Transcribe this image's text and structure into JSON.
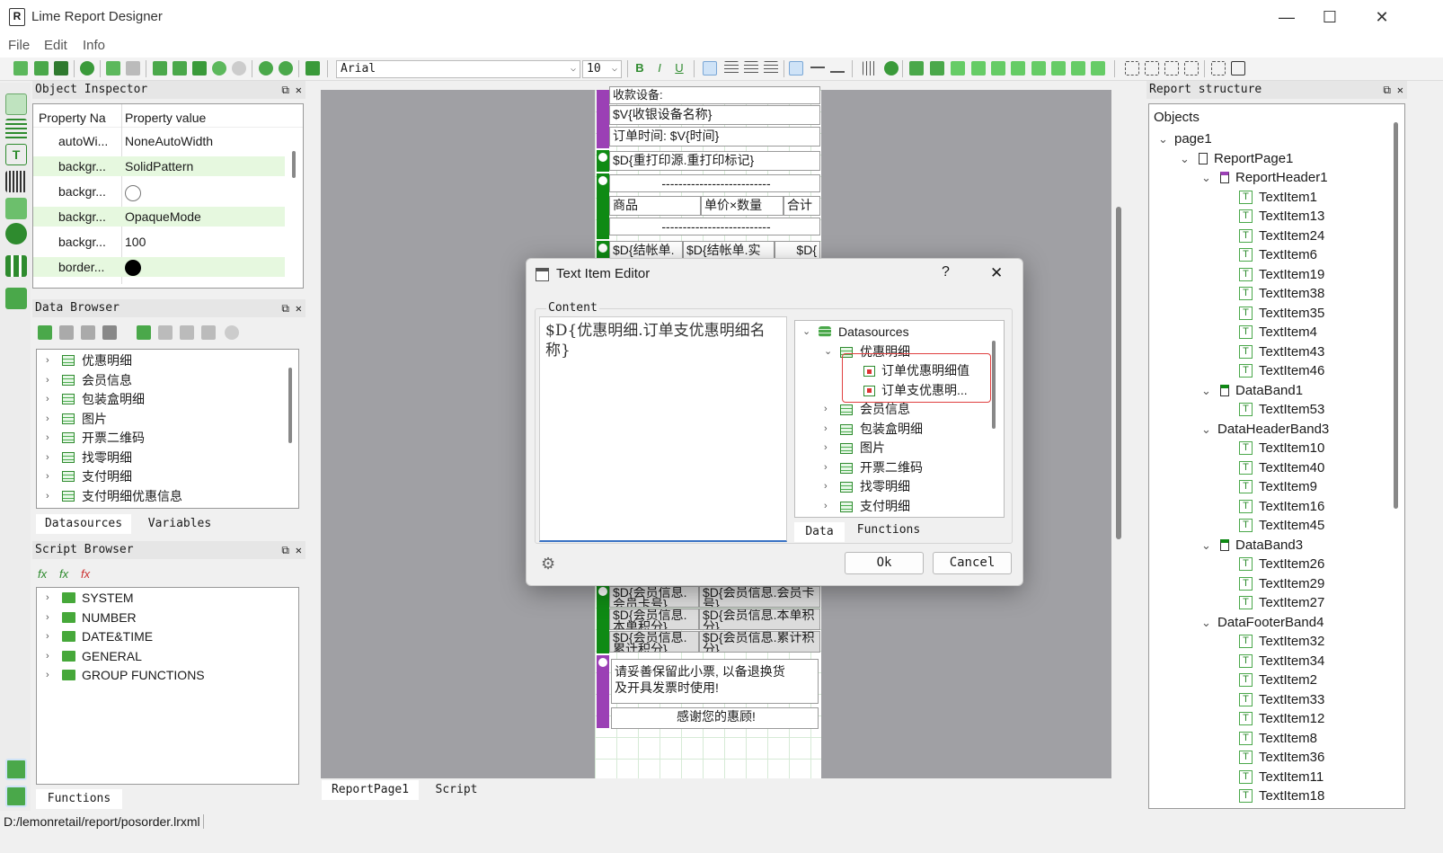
{
  "window": {
    "title": "Lime Report Designer",
    "minimize": "—",
    "maximize": "☐",
    "close": "✕"
  },
  "menu": [
    "File",
    "Edit",
    "Info"
  ],
  "toolbar": {
    "font": "Arial",
    "size": "10"
  },
  "object_inspector": {
    "title": "Object Inspector",
    "headers": [
      "Property Na",
      "Property value"
    ],
    "rows": [
      {
        "name": "autoWi...",
        "value": "NoneAutoWidth"
      },
      {
        "name": "backgr...",
        "value": "SolidPattern"
      },
      {
        "name": "backgr...",
        "value": ""
      },
      {
        "name": "backgr...",
        "value": "OpaqueMode"
      },
      {
        "name": "backgr...",
        "value": "100"
      },
      {
        "name": "border...",
        "value": ""
      }
    ]
  },
  "data_browser": {
    "title": "Data Browser",
    "items": [
      "优惠明细",
      "会员信息",
      "包装盒明细",
      "图片",
      "开票二维码",
      "找零明细",
      "支付明细",
      "支付明细优惠信息"
    ],
    "tabs": [
      "Datasources",
      "Variables"
    ]
  },
  "script_browser": {
    "title": "Script Browser",
    "items": [
      "SYSTEM",
      "NUMBER",
      "DATE&TIME",
      "GENERAL",
      "GROUP FUNCTIONS"
    ],
    "tabs": [
      "Functions"
    ]
  },
  "report": {
    "cells": [
      "收款设备:",
      "$V{收银设备名称}",
      "订单时间: $V{时间}",
      "$D{重打印源.重打印标记}",
      "--------------------------",
      "商品",
      "单价×数量",
      "合计",
      "--------------------------",
      "$D{结帐单.",
      "$D{结帐单.实",
      "$D{",
      "$D{会员信息.会员卡号}",
      "$D{会员信息.会员卡号}",
      "$D{会员信息.本单积分}",
      "$D{会员信息.本单积分}",
      "$D{会员信息.累计积分}",
      "$D{会员信息.累计积分}",
      "请妥善保留此小票, 以备退换货",
      "及开具发票时使用!",
      "感谢您的惠顾!"
    ],
    "tabs": [
      "ReportPage1",
      "Script"
    ]
  },
  "dialog": {
    "title": "Text Item Editor",
    "help": "?",
    "close": "✕",
    "content_label": "Content",
    "content_text": "$D{优惠明细.订单支优惠明细名称}",
    "tree": {
      "root": "Datasources",
      "expanded": "优惠明细",
      "fields": [
        "订单优惠明细值",
        "订单支优惠明..."
      ],
      "others": [
        "会员信息",
        "包装盒明细",
        "图片",
        "开票二维码",
        "找零明细",
        "支付明细"
      ]
    },
    "tabs": [
      "Data",
      "Functions"
    ],
    "ok": "Ok",
    "cancel": "Cancel"
  },
  "report_structure": {
    "title": "Report structure",
    "objects_label": "Objects",
    "tree": [
      {
        "label": "page1",
        "level": 0,
        "type": "expand"
      },
      {
        "label": "ReportPage1",
        "level": 1,
        "type": "page"
      },
      {
        "label": "ReportHeader1",
        "level": 2,
        "type": "band"
      },
      {
        "label": "TextItem1",
        "level": 3,
        "type": "text"
      },
      {
        "label": "TextItem13",
        "level": 3,
        "type": "text"
      },
      {
        "label": "TextItem24",
        "level": 3,
        "type": "text"
      },
      {
        "label": "TextItem6",
        "level": 3,
        "type": "text"
      },
      {
        "label": "TextItem19",
        "level": 3,
        "type": "text"
      },
      {
        "label": "TextItem38",
        "level": 3,
        "type": "text"
      },
      {
        "label": "TextItem35",
        "level": 3,
        "type": "text"
      },
      {
        "label": "TextItem4",
        "level": 3,
        "type": "text"
      },
      {
        "label": "TextItem43",
        "level": 3,
        "type": "text"
      },
      {
        "label": "TextItem46",
        "level": 3,
        "type": "text"
      },
      {
        "label": "DataBand1",
        "level": 2,
        "type": "band"
      },
      {
        "label": "TextItem53",
        "level": 3,
        "type": "text"
      },
      {
        "label": "DataHeaderBand3",
        "level": 2,
        "type": "none"
      },
      {
        "label": "TextItem10",
        "level": 3,
        "type": "text"
      },
      {
        "label": "TextItem40",
        "level": 3,
        "type": "text"
      },
      {
        "label": "TextItem9",
        "level": 3,
        "type": "text"
      },
      {
        "label": "TextItem16",
        "level": 3,
        "type": "text"
      },
      {
        "label": "TextItem45",
        "level": 3,
        "type": "text"
      },
      {
        "label": "DataBand3",
        "level": 2,
        "type": "band"
      },
      {
        "label": "TextItem26",
        "level": 3,
        "type": "text"
      },
      {
        "label": "TextItem29",
        "level": 3,
        "type": "text"
      },
      {
        "label": "TextItem27",
        "level": 3,
        "type": "text"
      },
      {
        "label": "DataFooterBand4",
        "level": 2,
        "type": "none"
      },
      {
        "label": "TextItem32",
        "level": 3,
        "type": "text"
      },
      {
        "label": "TextItem34",
        "level": 3,
        "type": "text"
      },
      {
        "label": "TextItem2",
        "level": 3,
        "type": "text"
      },
      {
        "label": "TextItem33",
        "level": 3,
        "type": "text"
      },
      {
        "label": "TextItem12",
        "level": 3,
        "type": "text"
      },
      {
        "label": "TextItem8",
        "level": 3,
        "type": "text"
      },
      {
        "label": "TextItem36",
        "level": 3,
        "type": "text"
      },
      {
        "label": "TextItem11",
        "level": 3,
        "type": "text"
      },
      {
        "label": "TextItem18",
        "level": 3,
        "type": "text"
      }
    ]
  },
  "status": "D:/lemonretail/report/posorder.lrxml",
  "colors": {
    "band_purple": "#9b40b5",
    "band_green": "#0f8a14",
    "highlight_row": "#e6f8df",
    "accent_red": "#e04040"
  }
}
